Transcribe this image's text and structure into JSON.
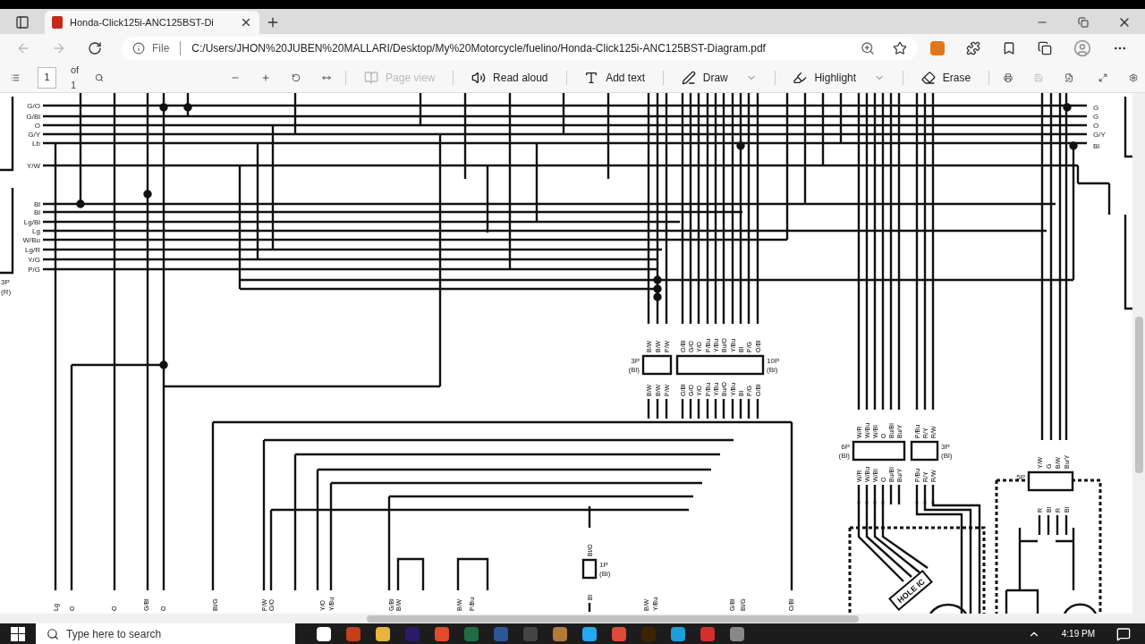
{
  "browser": {
    "tab_title": "Honda-Click125i-ANC125BST-Di",
    "address_prefix": "File",
    "url": "C:/Users/JHON%20JUBEN%20MALLARI/Desktop/My%20Motorcycle/fuelino/Honda-Click125i-ANC125BST-Diagram.pdf"
  },
  "pdf_toolbar": {
    "page": "1",
    "page_count": "of 1",
    "items": [
      {
        "label": "Page view",
        "disabled": true,
        "dropdown": false
      },
      {
        "label": "Read aloud",
        "disabled": false,
        "dropdown": false
      },
      {
        "label": "Add text",
        "disabled": false,
        "dropdown": false
      },
      {
        "label": "Draw",
        "disabled": false,
        "dropdown": true
      },
      {
        "label": "Highlight",
        "disabled": false,
        "dropdown": true
      },
      {
        "label": "Erase",
        "disabled": false,
        "dropdown": false
      }
    ]
  },
  "diagram": {
    "left_labels": [
      "G/O",
      "G/Bl",
      "O",
      "G/Y",
      "Lb",
      "Y/W",
      "Bl",
      "Bl",
      "Lg/Bl",
      "Lg",
      "W/Bu",
      "Lg/R",
      "Y/G",
      "P/G"
    ],
    "left_connector": [
      "3P",
      "(R)"
    ],
    "right_labels": [
      "G",
      "G",
      "O",
      "G/Y",
      "Bl"
    ],
    "connectors": [
      {
        "name": "3P",
        "housing": "(Bl)",
        "wires_top": [
          "B/W",
          "B/W",
          "P/W"
        ],
        "wires_bottom": [
          "B/W",
          "B/W",
          "P/W"
        ]
      },
      {
        "name": "10P",
        "housing": "(Bl)",
        "wires_top": [
          "O/Bl",
          "G/O",
          "Y/O",
          "P/Bu",
          "Y/Bu",
          "Bu/O",
          "Y/Bu",
          "Bl",
          "P/G",
          "O/Bl"
        ],
        "wires_bottom": [
          "O/Bl",
          "G/O",
          "Y/O",
          "P/Bu",
          "Y/Bu",
          "Bu/O",
          "Y/Bu",
          "Bl",
          "P/G",
          "O/Bl"
        ]
      },
      {
        "name": "6P",
        "housing": "(Bl)",
        "wires_top": [
          "W/R",
          "W/Bu",
          "W/Bl",
          "O",
          "Bu/Bl",
          "Bu/Y"
        ],
        "wires_bottom": [
          "W/R",
          "W/Bu",
          "W/Bl",
          "O",
          "Bu/Bl",
          "Bu/Y"
        ]
      },
      {
        "name": "3P",
        "housing": "(Bl)",
        "wires_top": [
          "P/Bu",
          "R/Y",
          "R/W"
        ],
        "wires_bottom": [
          "P/Bu",
          "R/Y",
          "R/W"
        ]
      },
      {
        "name": "5P",
        "wires_top": [
          "Y/W",
          "G",
          "B/W",
          "Bu/Y"
        ],
        "wires_bottom": [
          "R",
          "Bl",
          "R",
          "Bl"
        ]
      },
      {
        "name": "1P",
        "housing": "(Bl)",
        "wires_top": [
          "Bl/O"
        ],
        "wires_bottom": [
          "Bl"
        ]
      }
    ],
    "hall_ic": "HOLE IC",
    "bottom_labels": [
      "Lg",
      "O",
      "O",
      "G/Bl",
      "O",
      "Bl/G",
      "P/W",
      "O/O",
      "Y/O",
      "Y/Bu",
      "G/Bl",
      "B/W",
      "B/W",
      "P/Bu",
      "B/W",
      "Y/Bu",
      "G/Bl",
      "Bl/G",
      "O/Bl"
    ]
  },
  "taskbar": {
    "search_placeholder": "Type here to search",
    "time": "4:19 PM"
  }
}
